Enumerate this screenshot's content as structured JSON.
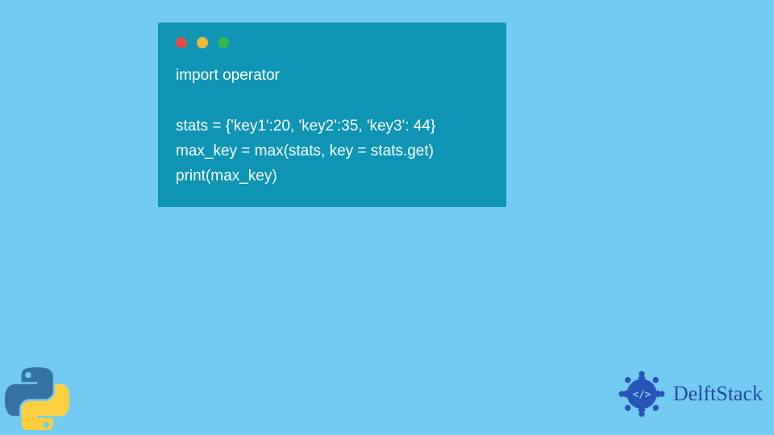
{
  "code": {
    "lines": [
      "import operator",
      "",
      "stats = {'key1':20, 'key2':35, 'key3': 44}",
      "max_key = max(stats, key = stats.get)",
      "print(max_key)"
    ]
  },
  "brand": {
    "name": "DelftStack"
  },
  "colors": {
    "background": "#74cbf2",
    "card": "#0e95b4",
    "dot_red": "#e64b43",
    "dot_yellow": "#f0b93a",
    "dot_green": "#33b84b",
    "brand_text": "#254a9e"
  }
}
